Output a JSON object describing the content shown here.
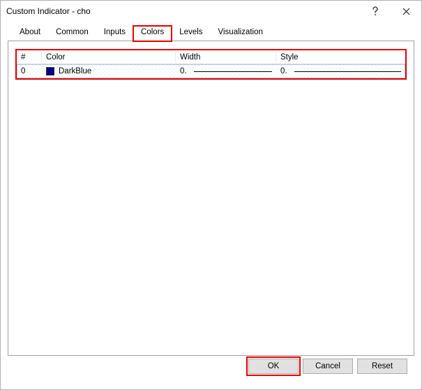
{
  "window": {
    "title": "Custom Indicator - cho"
  },
  "tabs": {
    "about": "About",
    "common": "Common",
    "inputs": "Inputs",
    "colors": "Colors",
    "levels": "Levels",
    "visualization": "Visualization",
    "active": "colors"
  },
  "table": {
    "headers": {
      "index": "#",
      "color": "Color",
      "width": "Width",
      "style": "Style"
    },
    "rows": [
      {
        "index": "0",
        "color_name": "DarkBlue",
        "color_hex": "#00008b",
        "width": "0.",
        "style": "0."
      }
    ]
  },
  "buttons": {
    "ok": "OK",
    "cancel": "Cancel",
    "reset": "Reset"
  }
}
